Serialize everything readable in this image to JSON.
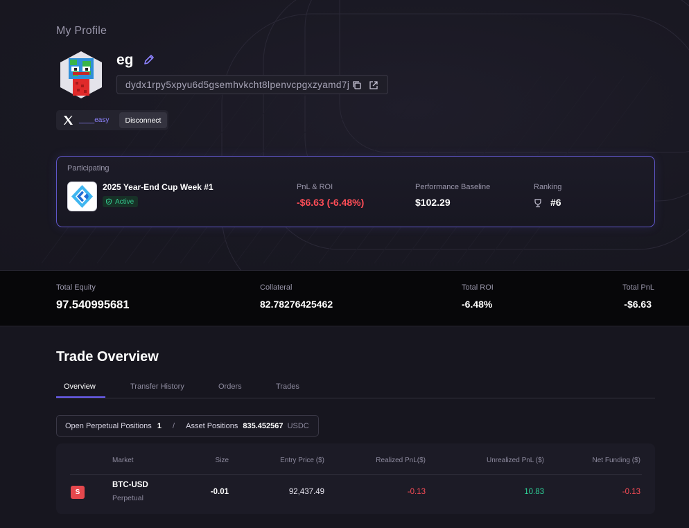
{
  "page": {
    "title": "My Profile"
  },
  "profile": {
    "username": "eg",
    "address": "dydx1rpy5xpyu6d5gsemhvkcht8lpenvcpgxzyamd7j",
    "social": {
      "handle": "____easy",
      "disconnect_label": "Disconnect"
    }
  },
  "contest": {
    "status_label": "Participating",
    "name": "2025 Year-End Cup Week #1",
    "badge": "Active",
    "pnl_label": "PnL & ROI",
    "pnl_value": "-$6.63 (-6.48%)",
    "baseline_label": "Performance Baseline",
    "baseline_value": "$102.29",
    "ranking_label": "Ranking",
    "ranking_value": "#6"
  },
  "summary": {
    "total_equity_label": "Total Equity",
    "total_equity_value": "97.540995681",
    "collateral_label": "Collateral",
    "collateral_value": "82.78276425462",
    "total_roi_label": "Total ROI",
    "total_roi_value": "-6.48%",
    "total_pnl_label": "Total PnL",
    "total_pnl_value": "-$6.63"
  },
  "trade_overview": {
    "title": "Trade Overview",
    "tabs": [
      {
        "label": "Overview"
      },
      {
        "label": "Transfer History"
      },
      {
        "label": "Orders"
      },
      {
        "label": "Trades"
      }
    ],
    "active_tab": "Overview",
    "positions_summary": {
      "open_label": "Open Perpetual Positions",
      "open_count": "1",
      "separator": "/",
      "asset_label": "Asset Positions",
      "asset_value": "835.452567",
      "asset_unit": "USDC"
    },
    "table": {
      "headers": [
        "Market",
        "Size",
        "Entry Price ($)",
        "Realized PnL($)",
        "Unrealized PnL ($)",
        "Net Funding ($)"
      ],
      "rows": [
        {
          "side": "S",
          "market": "BTC-USD",
          "market_type": "Perpetual",
          "size": "-0.01",
          "entry_price": "92,437.49",
          "realized_pnl": "-0.13",
          "unrealized_pnl": "10.83",
          "net_funding": "-0.13"
        }
      ]
    }
  },
  "colors": {
    "background": "#17161f",
    "accent": "#6c5ff5",
    "negative": "#ff4d57",
    "positive": "#2fd49a",
    "active_badge": "#33c48b"
  },
  "icons": [
    "edit-icon",
    "copy-icon",
    "external-link-icon",
    "x-logo-icon",
    "check-shield-icon",
    "trophy-icon",
    "contest-logo-icon"
  ]
}
